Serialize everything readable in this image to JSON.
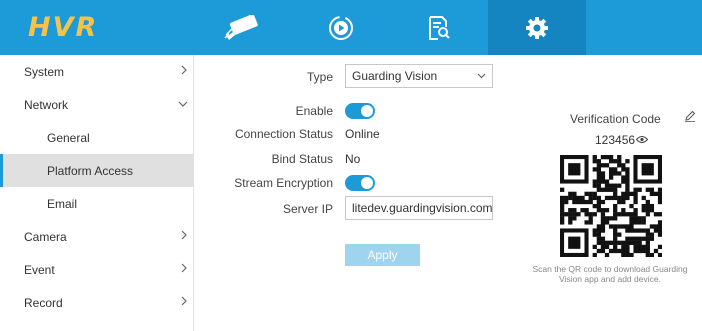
{
  "app": {
    "logo": "HVR"
  },
  "nav": {
    "tabs": [
      {
        "icon": "camera-icon",
        "active": false
      },
      {
        "icon": "playback-icon",
        "active": false
      },
      {
        "icon": "search-file-icon",
        "active": false
      },
      {
        "icon": "gear-icon",
        "active": true
      }
    ]
  },
  "sidebar": {
    "items": [
      {
        "label": "System",
        "expanded": false
      },
      {
        "label": "Network",
        "expanded": true
      },
      {
        "label": "General"
      },
      {
        "label": "Platform Access",
        "selected": true
      },
      {
        "label": "Email"
      },
      {
        "label": "Camera",
        "expanded": false
      },
      {
        "label": "Event",
        "expanded": false
      },
      {
        "label": "Record",
        "expanded": false
      }
    ]
  },
  "form": {
    "type_label": "Type",
    "type_value": "Guarding Vision",
    "enable_label": "Enable",
    "enable_on": true,
    "connection_status_label": "Connection Status",
    "connection_status_value": "Online",
    "bind_status_label": "Bind Status",
    "bind_status_value": "No",
    "stream_encryption_label": "Stream Encryption",
    "stream_encryption_on": true,
    "server_ip_label": "Server IP",
    "server_ip_value": "litedev.guardingvision.com",
    "apply_label": "Apply"
  },
  "verification": {
    "title": "Verification Code",
    "code": "123456",
    "qr_caption": "Scan the QR code to download Guarding Vision app and add device."
  },
  "colors": {
    "accent": "#1d9bd8",
    "logo": "#f5c24a",
    "active_tab": "#1585c2"
  }
}
